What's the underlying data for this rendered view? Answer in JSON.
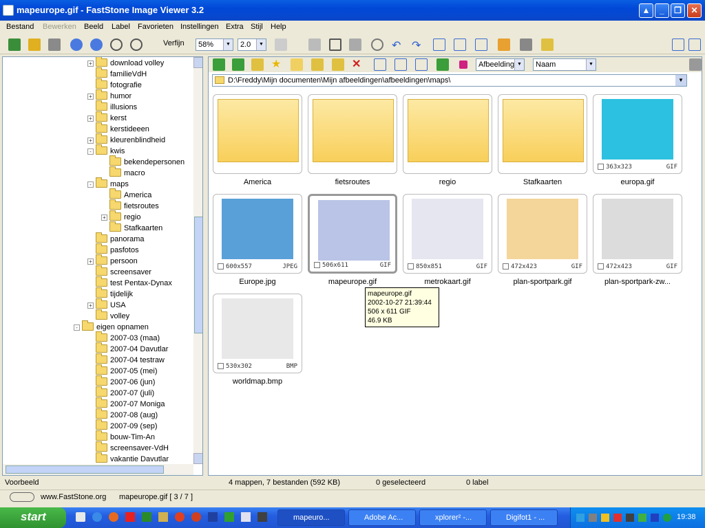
{
  "window": {
    "title": "mapeurope.gif - FastStone Image Viewer 3.2"
  },
  "menu": [
    "Bestand",
    "Bewerken",
    "Beeld",
    "Label",
    "Favorieten",
    "Instellingen",
    "Extra",
    "Stijl",
    "Help"
  ],
  "toolbar": {
    "smooth_label": "Verfijn",
    "zoom_value": "58%",
    "ratio_value": "2.0"
  },
  "toolbar2": {
    "sort_mode": "Afbeelding",
    "sort_by": "Naam"
  },
  "path": "D:\\Freddy\\Mijn documenten\\Mijn afbeeldingen\\afbeeldingen\\maps\\",
  "tree": [
    {
      "label": "download volley"
    },
    {
      "label": "familieVdH"
    },
    {
      "label": "fotografie"
    },
    {
      "label": "humor"
    },
    {
      "label": "illusions"
    },
    {
      "label": "kerst"
    },
    {
      "label": "kerstideeen"
    },
    {
      "label": "kleurenblindheid"
    },
    {
      "label": "kwis"
    },
    {
      "label": "bekendepersonen"
    },
    {
      "label": "macro"
    },
    {
      "label": "maps"
    },
    {
      "label": "America"
    },
    {
      "label": "fietsroutes"
    },
    {
      "label": "regio"
    },
    {
      "label": "Stafkaarten"
    },
    {
      "label": "panorama"
    },
    {
      "label": "pasfotos"
    },
    {
      "label": "persoon"
    },
    {
      "label": "screensaver"
    },
    {
      "label": "test Pentax-Dynax"
    },
    {
      "label": "tijdelijk"
    },
    {
      "label": "USA"
    },
    {
      "label": "volley"
    },
    {
      "label": "eigen opnamen"
    },
    {
      "label": "2007-03 (maa)"
    },
    {
      "label": "2007-04 Davutlar"
    },
    {
      "label": "2007-04 testraw"
    },
    {
      "label": "2007-05 (mei)"
    },
    {
      "label": "2007-06 (jun)"
    },
    {
      "label": "2007-07 (juli)"
    },
    {
      "label": "2007-07 Moniga"
    },
    {
      "label": "2007-08 (aug)"
    },
    {
      "label": "2007-09 (sep)"
    },
    {
      "label": "bouw-Tim-An"
    },
    {
      "label": "screensaver-VdH"
    },
    {
      "label": "vakantie Davutlar"
    }
  ],
  "thumbnails": [
    {
      "name": "America",
      "kind": "folder",
      "dims": "",
      "format": ""
    },
    {
      "name": "fietsroutes",
      "kind": "folder",
      "dims": "",
      "format": ""
    },
    {
      "name": "regio",
      "kind": "folder",
      "dims": "",
      "format": ""
    },
    {
      "name": "Stafkaarten",
      "kind": "folder",
      "dims": "",
      "format": ""
    },
    {
      "name": "europa.gif",
      "kind": "image",
      "dims": "363x323",
      "format": "GIF"
    },
    {
      "name": "Europe.jpg",
      "kind": "image",
      "dims": "600x557",
      "format": "JPEG"
    },
    {
      "name": "mapeurope.gif",
      "kind": "image",
      "dims": "506x611",
      "format": "GIF"
    },
    {
      "name": "metrokaart.gif",
      "kind": "image",
      "dims": "850x851",
      "format": "GIF"
    },
    {
      "name": "plan-sportpark.gif",
      "kind": "image",
      "dims": "472x423",
      "format": "GIF"
    },
    {
      "name": "plan-sportpark-zw...",
      "kind": "image",
      "dims": "472x423",
      "format": "GIF"
    },
    {
      "name": "worldmap.bmp",
      "kind": "image",
      "dims": "530x302",
      "format": "BMP"
    }
  ],
  "tooltip": {
    "line1": "mapeurope.gif",
    "line2": "2002-10-27 21:39:44",
    "line3": "506 x 611  GIF",
    "line4": "46.9 KB"
  },
  "status": {
    "summary": "4 mappen, 7 bestanden (592 KB)",
    "selected": "0 geselecteerd",
    "labels": "0 label",
    "preview": "Voorbeeld",
    "website": "www.FastStone.org",
    "current": "mapeurope.gif [ 3 / 7 ]"
  },
  "taskbar": {
    "start": "start",
    "tasks": [
      "mapeuro...",
      "Adobe Ac...",
      "xplorer² -...",
      "Digifot1 - ..."
    ],
    "clock": "19:38"
  }
}
